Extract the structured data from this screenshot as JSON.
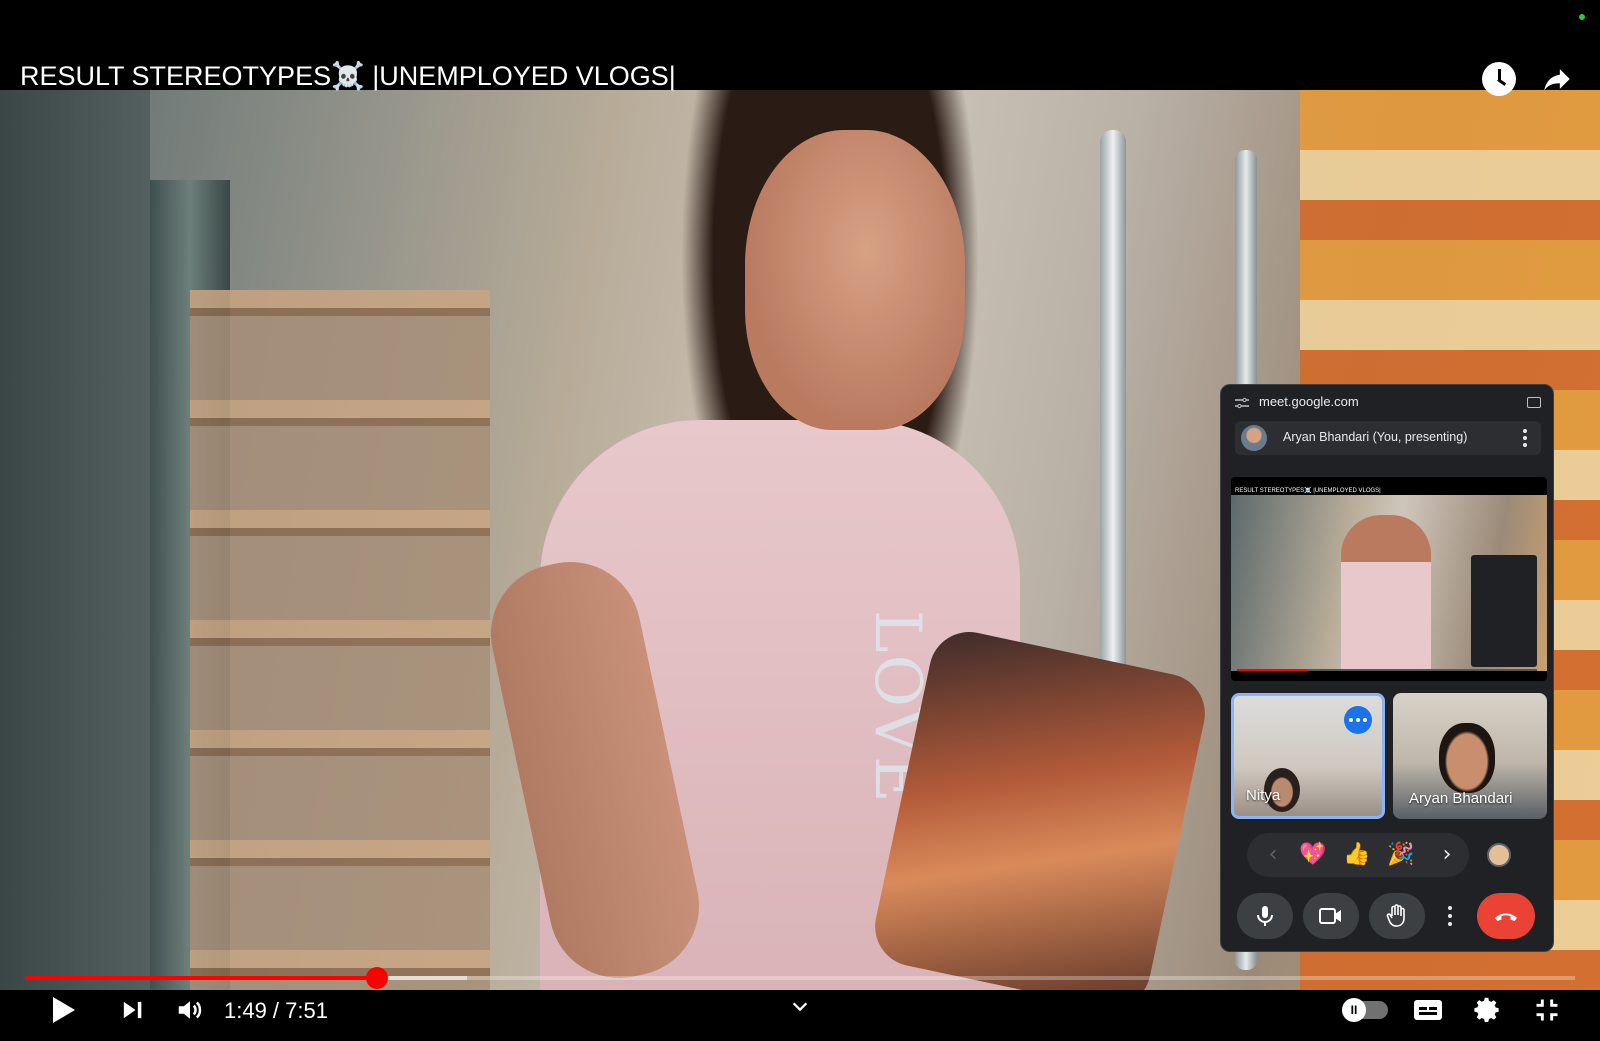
{
  "player": {
    "title": "RESULT STEREOTYPES☠️ |UNEMPLOYED VLOGS|",
    "icons": {
      "watch_later": "clock-icon",
      "share": "share-icon",
      "play": "play-icon",
      "next": "next-icon",
      "volume": "volume-icon",
      "chevron": "chevron-down-icon",
      "autoplay": "autoplay-toggle-icon",
      "captions": "captions-icon",
      "settings": "gear-icon",
      "fullscreen_exit": "fullscreen-exit-icon"
    },
    "scene_text": "LOVE",
    "time": "1:49 / 7:51",
    "progress_played": 0.2268,
    "progress_buffered": 0.285,
    "autoplay_glyph": "II",
    "accent_color": "#ff0000"
  },
  "meet": {
    "url": "meet.google.com",
    "presenter": "Aryan Bhandari (You, presenting)",
    "screen_share_title": "RESULT STEREOTYPES☠️ |UNEMPLOYED VLOGS|",
    "participants": [
      {
        "name": "Nitya",
        "active_speaker": true
      },
      {
        "name": "Aryan Bhandari",
        "active_speaker": false
      }
    ],
    "reactions": [
      "‹",
      "💖",
      "👍",
      "🎉",
      "›"
    ],
    "icons": {
      "tune": "tune-icon",
      "pip": "pip-icon",
      "menu": "kebab-icon",
      "tile_more": "more-horiz-icon",
      "mic": "mic-icon",
      "camera": "camera-icon",
      "hand": "raise-hand-icon",
      "more": "more-vert-icon",
      "hangup": "hang-up-icon"
    },
    "colors": {
      "panel": "#202124",
      "active_border": "#8ab4f8",
      "hangup": "#ea4335"
    }
  }
}
